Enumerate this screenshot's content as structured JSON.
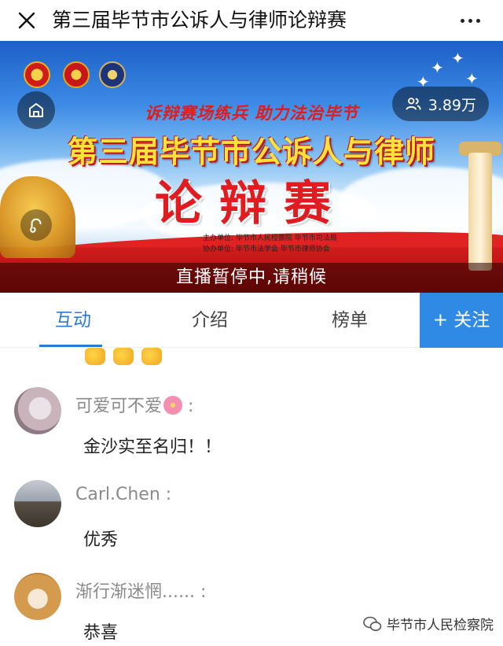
{
  "topbar": {
    "title": "第三届毕节市公诉人与律师论辩赛",
    "close_icon": "close-icon",
    "more_icon": "more-icon"
  },
  "banner": {
    "slogan": "诉辩赛场练兵  助力法治毕节",
    "main_title": "第三届毕节市公诉人与律师",
    "big_title": "论辩赛",
    "organizer_line1": "主办单位:  毕节市人民检察院   毕节市司法局",
    "organizer_line2": "协办单位:  毕节市法学会   毕节市律师协会",
    "viewer_count": "3.89万",
    "status": "直播暂停中,请稍候"
  },
  "tabs": [
    {
      "label": "互动",
      "active": true
    },
    {
      "label": "介绍",
      "active": false
    },
    {
      "label": "榜单",
      "active": false
    }
  ],
  "follow_label": "+ 关注",
  "comments": [
    {
      "username": "可爱可不爱",
      "suffix": " :",
      "message": "金沙实至名归！！"
    },
    {
      "username": "Carl.Chen :",
      "message": "优秀"
    },
    {
      "username": "渐行渐迷惘...... :",
      "message": "恭喜"
    }
  ],
  "watermark": "毕节市人民检察院",
  "colors": {
    "accent": "#2c7ad6",
    "follow_bg": "#2f8ae6",
    "banner_red": "#e11c20",
    "title_yellow": "#ffe23a"
  }
}
